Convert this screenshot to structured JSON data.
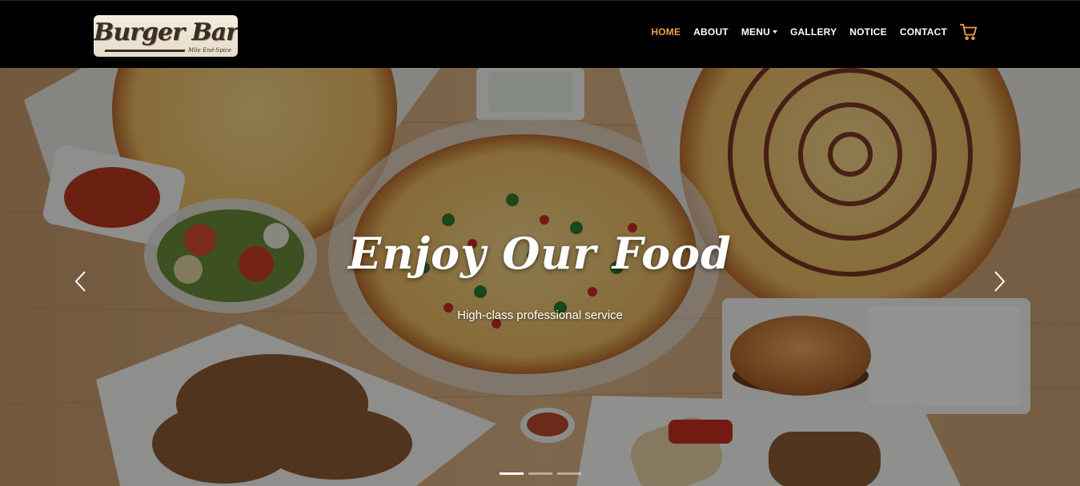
{
  "brand": {
    "name": "Burger Bar",
    "tagline": "Mile End-Spice"
  },
  "nav": {
    "items": [
      {
        "label": "HOME",
        "active": true
      },
      {
        "label": "ABOUT",
        "active": false
      },
      {
        "label": "MENU",
        "active": false,
        "dropdown": true
      },
      {
        "label": "GALLERY",
        "active": false
      },
      {
        "label": "NOTICE",
        "active": false
      },
      {
        "label": "CONTACT",
        "active": false
      }
    ],
    "cart_icon": "shopping-cart-icon"
  },
  "hero": {
    "title": "Enjoy Our Food",
    "subtitle": "High-class professional service",
    "prev_icon": "chevron-left-icon",
    "next_icon": "chevron-right-icon",
    "slides_count": 3,
    "active_slide": 1
  },
  "colors": {
    "navbar_bg": "#000000",
    "accent": "#f0a04b",
    "text": "#ffffff"
  }
}
